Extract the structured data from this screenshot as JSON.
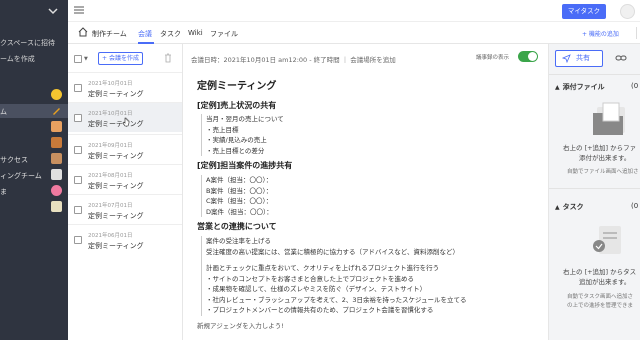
{
  "sidebar": {
    "links": [
      {
        "label": "クスペースに招待"
      },
      {
        "label": "ームを作成"
      }
    ],
    "items": [
      {
        "label": "",
        "emoji_color": "#f4c430"
      },
      {
        "label": "ム",
        "emoji_color": "#e8a020"
      },
      {
        "label": "",
        "emoji_color": "#e8a060"
      },
      {
        "label": "",
        "emoji_color": "#c87a3a"
      },
      {
        "label": "サクセス",
        "emoji_color": "#c89060"
      },
      {
        "label": "ィングチーム",
        "emoji_color": "#e0e0e0"
      },
      {
        "label": "ま",
        "emoji_color": "#f07aa0"
      },
      {
        "label": "",
        "emoji_color": "#e8e0c0"
      }
    ]
  },
  "topbar": {
    "my_task_label": "マイタスク"
  },
  "tabs": {
    "team": "制作チーム",
    "items": [
      {
        "label": "会議"
      },
      {
        "label": "タスク"
      },
      {
        "label": "Wiki"
      },
      {
        "label": "ファイル"
      }
    ],
    "add_feature": "+ 機能の追加"
  },
  "list": {
    "create_label": "+ 会議を作成",
    "rows": [
      {
        "date": "2021年10月01日",
        "title": "定例ミーティング"
      },
      {
        "date": "2021年10月01日",
        "title": "定例ミーティング"
      },
      {
        "date": "2021年09月01日",
        "title": "定例ミーティング"
      },
      {
        "date": "2021年08月01日",
        "title": "定例ミーティング"
      },
      {
        "date": "2021年07月01日",
        "title": "定例ミーティング"
      },
      {
        "date": "2021年06月01日",
        "title": "定例ミーティング"
      }
    ]
  },
  "doc": {
    "meta": "会議日時：2021年10月01日 am12:00 - 終了時間 ｜ 会議場所を追加",
    "toggle_label": "議事録の表示",
    "title": "定例ミーティング",
    "sections": [
      {
        "heading": "[定例]売上状況の共有",
        "lines": [
          "当月・翌月の売上について",
          "・売上目標",
          "・実績/見込みの売上",
          "・売上目標との差分"
        ]
      },
      {
        "heading": "[定例]担当案件の進捗共有",
        "lines": [
          "A案件（担当：〇〇）：",
          "B案件（担当：〇〇）：",
          "C案件（担当：〇〇）：",
          "D案件（担当：〇〇）："
        ]
      },
      {
        "heading": "営業との連携について",
        "lines": [
          "案件の受注率を上げる",
          "受注確度の高い提案には、営業に積極的に協力する（アドバイスなど、資料添削など）",
          "",
          "計画とチェックに重点をおいて、クオリティを上げれるプロジェクト進行を行う",
          "・サイトのコンセプトをお客さまと合意した上でプロジェクトを進める",
          "・成果物を確認して、仕様のズレやミスを防ぐ（デザイン、テストサイト）",
          "・社内レビュー・ブラッシュアップを考えて、2、3日余裕を持ったスケジュールを立てる",
          "・プロジェクトメンバーとの情報共有のため、プロジェクト会議を習慣化する"
        ]
      }
    ],
    "footer": "新規アジェンダを入力しよう!"
  },
  "right": {
    "share_label": "共有",
    "attach": {
      "title": "添付ファイル",
      "count": "(0",
      "line1": "右上の [+追加] からファ",
      "line2": "添付が出来ます。",
      "note": "自動でファイル画面へ追加さ"
    },
    "task": {
      "title": "タスク",
      "count": "(0",
      "line1": "右上の [+追加] からタス",
      "line2": "追加が出来ます。",
      "note1": "自動でタスク画面へ追加さ",
      "note2": "の上での進捗を管理できま"
    }
  }
}
